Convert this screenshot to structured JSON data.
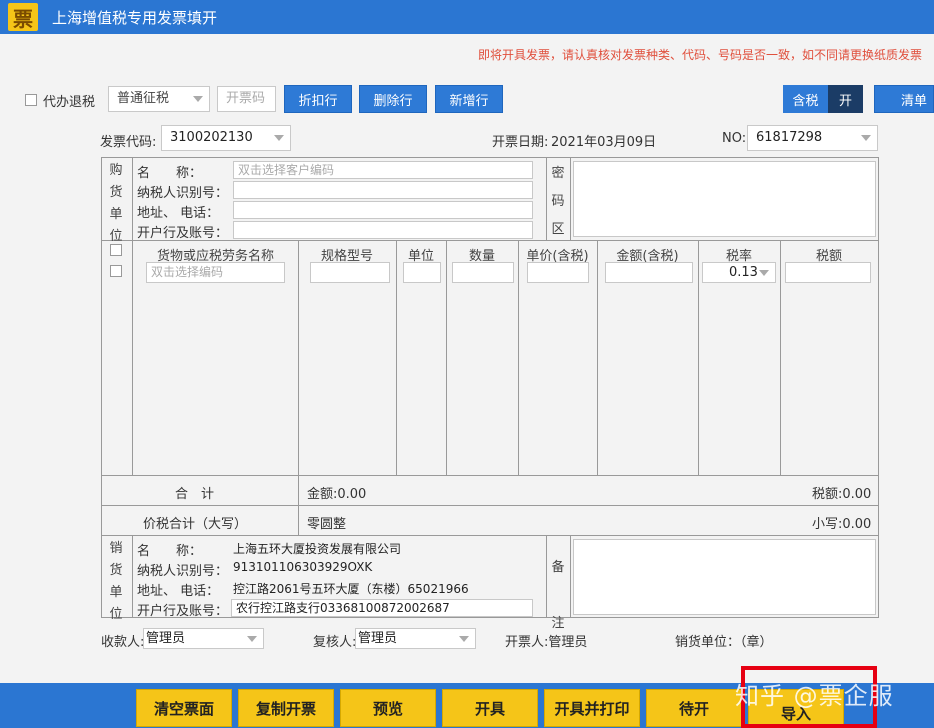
{
  "app": {
    "logo_char": "票",
    "title": "上海增值税专用发票填开"
  },
  "notice": "即将开具发票，请认真核对发票种类、代码、号码是否一致，如不同请更换纸质发票",
  "toolbar": {
    "proxy_refund_label": "代办退税",
    "tax_type_value": "普通征税",
    "invoice_code_placeholder": "开票码",
    "discount_row": "折扣行",
    "delete_row": "删除行",
    "add_row": "新增行",
    "tax_included": "含税",
    "toggle_on": "开",
    "list": "清单"
  },
  "header": {
    "code_label": "发票代码:",
    "code_value": "3100202130",
    "date_label": "开票日期:",
    "date_value": "2021年03月09日",
    "no_label": "NO:",
    "no_value": "61817298"
  },
  "buyer": {
    "side_label": [
      "购",
      "货",
      "单",
      "位"
    ],
    "name_label": "名　　称：",
    "name_placeholder": "双击选择客户编码",
    "taxid_label": "纳税人识别号：",
    "addr_label": "地址、  电话：",
    "bank_label": "开户行及账号："
  },
  "password_area": [
    "密",
    "码",
    "区"
  ],
  "items": {
    "columns": [
      "货物或应税劳务名称",
      "规格型号",
      "单位",
      "数量",
      "单价(含税)",
      "金额(含税)",
      "税率",
      "税额"
    ],
    "name_placeholder": "双击选择编码",
    "tax_rate_value": "0.13"
  },
  "total": {
    "label": "合　计",
    "amount": "金额:0.00",
    "tax": "税额:0.00"
  },
  "tax_total": {
    "label": "价税合计（大写）",
    "upper": "零圆整",
    "lower": "小写:0.00"
  },
  "seller": {
    "side_label": [
      "销",
      "货",
      "单",
      "位"
    ],
    "name_label": "名　　称：",
    "name_value": "上海五环大厦投资发展有限公司",
    "taxid_label": "纳税人识别号：",
    "taxid_value": "913101106303929OXK",
    "addr_label": "地址、  电话：",
    "addr_value": "控江路2061号五环大厦（东楼）65021966",
    "bank_label": "开户行及账号：",
    "bank_value": "农行控江路支行03368100872002687"
  },
  "remark": [
    "备",
    "注"
  ],
  "footer": {
    "payee_label": "收款人:",
    "payee_value": "管理员",
    "reviewer_label": "复核人:",
    "reviewer_value": "管理员",
    "drawer": "开票人:管理员",
    "seller_seal": "销货单位：（章）"
  },
  "actions": [
    "清空票面",
    "复制开票",
    "预览",
    "开具",
    "开具并打印",
    "待开",
    "导入"
  ],
  "watermark": "知乎 @票企服",
  "colors": {
    "primary": "#2b76d2",
    "action": "#f5c518",
    "notice": "#e04f3c",
    "highlight": "#e60012"
  }
}
